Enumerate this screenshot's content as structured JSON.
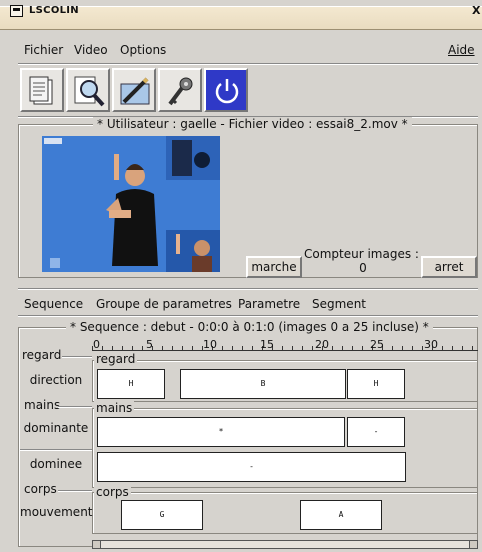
{
  "window": {
    "title": "LSCOLIN",
    "close_glyph": "X"
  },
  "menubar": {
    "items": [
      "Fichier",
      "Video",
      "Options"
    ],
    "help": "Aide"
  },
  "toolbar": {
    "icons": [
      "document-icon",
      "magnifier-icon",
      "pen-icon",
      "key-icon",
      "power-icon"
    ]
  },
  "video_panel": {
    "label": "* Utilisateur : gaelle  -  Fichier video : essai8_2.mov  *",
    "start_button": "marche",
    "stop_button": "arret",
    "counter_label": "Compteur images :",
    "counter_value": "0"
  },
  "sequence_menu": {
    "items": [
      "Sequence",
      "Groupe de parametres",
      "Parametre",
      "Segment"
    ]
  },
  "sequence_panel": {
    "label": "*  Sequence : debut  -  0:0:0 à 0:1:0  (images 0 a 25 incluse)  *",
    "ruler_ticks": [
      "0",
      "5",
      "10",
      "15",
      "20",
      "25",
      "30"
    ]
  },
  "groups": {
    "regard": {
      "name": "regard",
      "inner": "regard",
      "param": "direction",
      "segments": [
        "H",
        "B",
        "H"
      ]
    },
    "mains": {
      "name": "mains",
      "inner": "mains",
      "param1": "dominante",
      "segments1": [
        "*",
        "-"
      ],
      "param2": "dominee",
      "segments2": [
        "-"
      ]
    },
    "corps": {
      "name": "corps",
      "inner": "corps",
      "param": "mouvement",
      "segments": [
        "G",
        "A"
      ]
    }
  }
}
